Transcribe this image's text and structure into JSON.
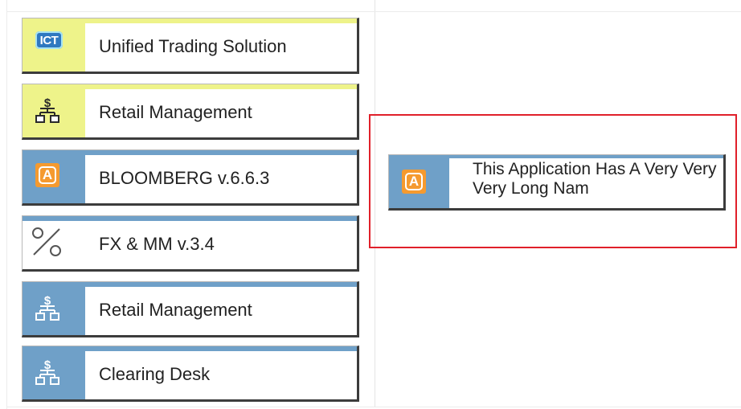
{
  "tiles": [
    {
      "label": "Unified Trading Solution",
      "icon": "ict-logo-icon",
      "color": "#eef38a"
    },
    {
      "label": "Retail Management",
      "icon": "org-chart-dollar-icon",
      "color": "#eef38a"
    },
    {
      "label": "BLOOMBERG v.6.6.3",
      "icon": "app-a-icon",
      "color": "#6fa0c8"
    },
    {
      "label": "FX & MM v.3.4",
      "icon": "percent-icon",
      "color": "#6fa0c8"
    },
    {
      "label": "Retail Management",
      "icon": "org-chart-dollar-icon",
      "color": "#6fa0c8"
    },
    {
      "label": "Clearing Desk",
      "icon": "org-chart-dollar-icon",
      "color": "#6fa0c8"
    }
  ],
  "ict_text": "ICT",
  "a_text": "A",
  "preview": {
    "label": "This Application Has A Very Very Very Long Nam",
    "icon": "app-a-icon",
    "highlight_color": "#e0202a"
  }
}
